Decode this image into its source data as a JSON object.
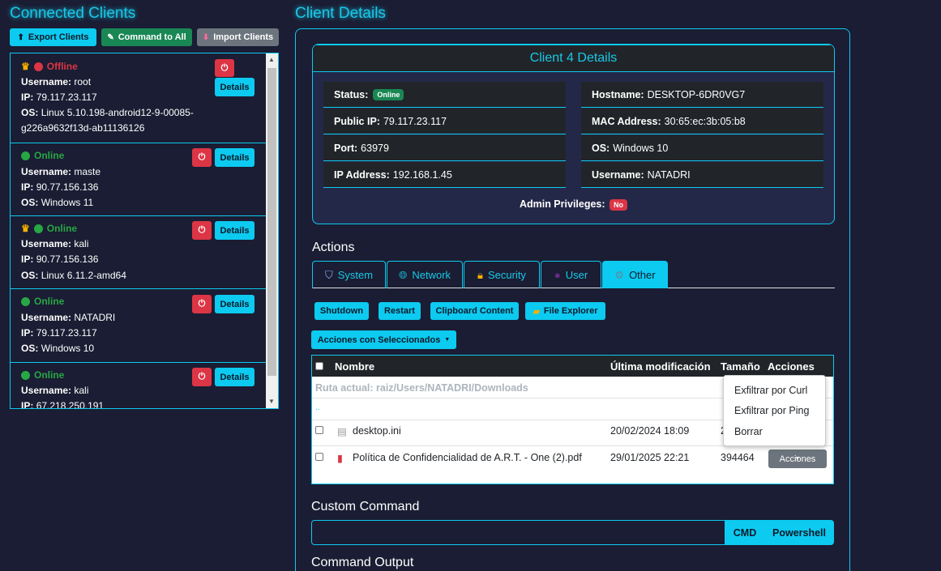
{
  "left": {
    "title": "Connected Clients",
    "buttons": {
      "export": "Export Clients",
      "command_all": "Command to All",
      "import": "Import Clients"
    },
    "details_label": "Details",
    "clients": [
      {
        "status": "Offline",
        "username_label": "Username:",
        "username": "root",
        "ip_label": "IP:",
        "ip": "79.117.23.117",
        "os_label": "OS:",
        "os": "Linux 5.10.198-android12-9-00085-",
        "os2": "g226a9632f13d-ab11136126"
      },
      {
        "status": "Online",
        "username_label": "Username:",
        "username": "maste",
        "ip_label": "IP:",
        "ip": "90.77.156.136",
        "os_label": "OS:",
        "os": "Windows 11"
      },
      {
        "status": "Online",
        "username_label": "Username:",
        "username": "kali",
        "ip_label": "IP:",
        "ip": "90.77.156.136",
        "os_label": "OS:",
        "os": "Linux 6.11.2-amd64"
      },
      {
        "status": "Online",
        "username_label": "Username:",
        "username": "NATADRI",
        "ip_label": "IP:",
        "ip": "79.117.23.117",
        "os_label": "OS:",
        "os": "Windows 10"
      },
      {
        "status": "Online",
        "username_label": "Username:",
        "username": "kali",
        "ip_label": "IP:",
        "ip": "67.218.250.191"
      }
    ]
  },
  "right": {
    "title": "Client Details",
    "info": {
      "header": "Client 4 Details",
      "status_label": "Status:",
      "status": "Online",
      "public_ip_label": "Public IP:",
      "public_ip": "79.117.23.117",
      "port_label": "Port:",
      "port": "63979",
      "ip_address_label": "IP Address:",
      "ip_address": "192.168.1.45",
      "hostname_label": "Hostname:",
      "hostname": "DESKTOP-6DR0VG7",
      "mac_label": "MAC Address:",
      "mac": "30:65:ec:3b:05:b8",
      "os_label": "OS:",
      "os": "Windows 10",
      "username_label": "Username:",
      "username": "NATADRI",
      "admin_label": "Admin Privileges:",
      "admin": "No"
    },
    "actions_title": "Actions",
    "tabs": [
      "System",
      "Network",
      "Security",
      "User",
      "Other"
    ],
    "active_tab": "Other",
    "action_buttons": {
      "shutdown": "Shutdown",
      "restart": "Restart",
      "clipboard": "Clipboard Content",
      "file_explorer": "File Explorer"
    },
    "selected_actions": "Acciones con Seleccionados",
    "file_table": {
      "headers": [
        "Nombre",
        "Última modificación",
        "Tamaño",
        "Acciones"
      ],
      "current_path": "Ruta actual: raiz/Users/NATADRI/Downloads",
      "parent": "..",
      "rows": [
        {
          "name": "desktop.ini",
          "modified": "20/02/2024 18:09",
          "size": "2"
        },
        {
          "name": "Política de Confidencialidad de A.R.T. - One (2).pdf",
          "modified": "29/01/2025 22:21",
          "size": "394464"
        }
      ],
      "actions_button": "Acciones"
    },
    "dropdown_items": [
      "Exfiltrar por Curl",
      "Exfiltrar por Ping",
      "Borrar"
    ],
    "custom_command_title": "Custom Command",
    "cmd_button": "CMD",
    "powershell_button": "Powershell",
    "command_output_title": "Command Output"
  }
}
